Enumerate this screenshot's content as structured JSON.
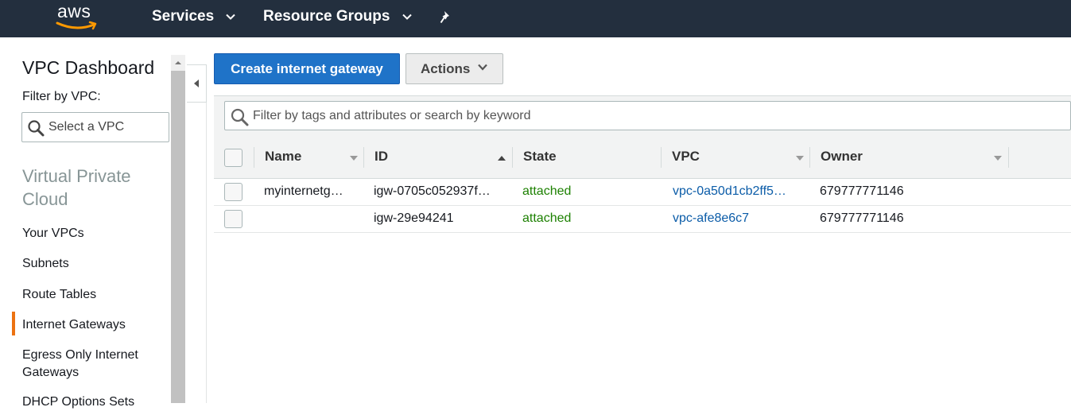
{
  "topnav": {
    "logo_text": "aws",
    "services_label": "Services",
    "resource_groups_label": "Resource Groups"
  },
  "sidebar": {
    "title": "VPC Dashboard",
    "filter_label": "Filter by VPC:",
    "select_placeholder": "Select a VPC",
    "section_title": "Virtual Private Cloud",
    "items": [
      {
        "label": "Your VPCs"
      },
      {
        "label": "Subnets"
      },
      {
        "label": "Route Tables"
      },
      {
        "label": "Internet Gateways",
        "active": true
      },
      {
        "label": "Egress Only Internet Gateways"
      },
      {
        "label": "DHCP Options Sets"
      }
    ]
  },
  "toolbar": {
    "create_label": "Create internet gateway",
    "actions_label": "Actions"
  },
  "filter": {
    "placeholder": "Filter by tags and attributes or search by keyword"
  },
  "table": {
    "columns": [
      "Name",
      "ID",
      "State",
      "VPC",
      "Owner"
    ],
    "rows": [
      {
        "name": "myinternetg…",
        "id": "igw-0705c052937f…",
        "state": "attached",
        "vpc": "vpc-0a50d1cb2ff5…",
        "owner": "679777771146"
      },
      {
        "name": "",
        "id": "igw-29e94241",
        "state": "attached",
        "vpc": "vpc-afe8e6c7",
        "owner": "679777771146"
      }
    ]
  },
  "colors": {
    "nav_bg": "#232f3e",
    "primary": "#1f73c8",
    "accent": "#ec7211",
    "state_green": "#1d8102",
    "link_blue": "#0b5ca8"
  }
}
